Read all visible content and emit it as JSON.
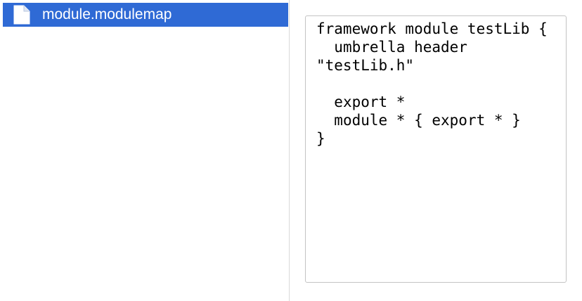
{
  "file_list": {
    "items": [
      {
        "name": "module.modulemap",
        "icon": "document-icon",
        "selected": true
      }
    ]
  },
  "preview": {
    "content": "framework module testLib {\n  umbrella header \"testLib.h\"\n\n  export *\n  module * { export * }\n}"
  },
  "colors": {
    "selection": "#2f6ad5",
    "selected_text": "#ffffff",
    "border": "#c3c3c3",
    "divider": "#d9d9d9"
  }
}
